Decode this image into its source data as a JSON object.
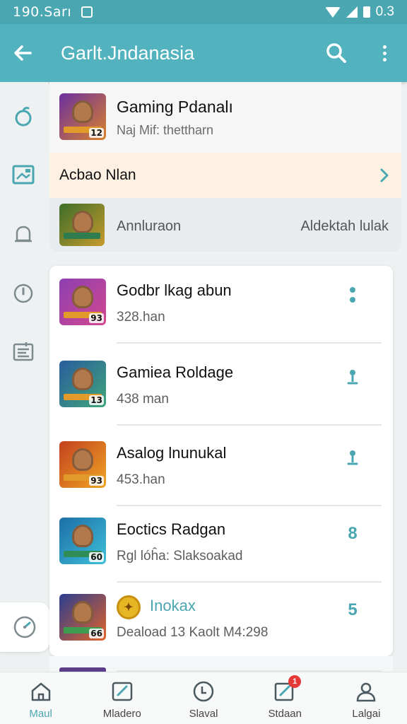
{
  "status_bar": {
    "time": "190.Sarı",
    "right_text": "0.3"
  },
  "app_bar": {
    "title": "Garlt.Jndanasia",
    "back_icon": "back-arrow-icon",
    "search_icon": "search-icon",
    "more_icon": "more-vert-icon"
  },
  "rail": {
    "items": [
      "apple-icon",
      "image-card-icon",
      "bell-icon",
      "clock-icon",
      "checklist-icon",
      "gauge-icon"
    ]
  },
  "featured": {
    "title": "Gaming Pdanalı",
    "subtitle": "Naj Mif: thettharn",
    "thumb_badge": "12",
    "action_label": "Acbao Nlan",
    "annotation_label": "Annluraon",
    "annotation_right": "Aldektah lulak"
  },
  "list": [
    {
      "title": "Godbr lkag abun",
      "subtitle": "328.han",
      "badge": "93",
      "action": "dots",
      "colors": [
        "#8d3fb3",
        "#d2488f"
      ]
    },
    {
      "title": "Gamiea Roldage",
      "subtitle": "438 man",
      "badge": "13",
      "action": "pin",
      "colors": [
        "#2a5d9e",
        "#3fa57a"
      ]
    },
    {
      "title": "Asalog lnunukal",
      "subtitle": "453.han",
      "badge": "93",
      "action": "pin",
      "colors": [
        "#c2411e",
        "#f0a524"
      ]
    },
    {
      "title": "Eoctics Radgan",
      "subtitle": "Rgl lóĥa: Slaksoakad",
      "badge": "60",
      "action": "8",
      "colors": [
        "#1d6ea8",
        "#3ec0d8"
      ]
    },
    {
      "title": "Inokax",
      "subtitle": "Deaload 13 Kaolt M4:298",
      "badge": "66",
      "action": "5",
      "colors": [
        "#2b3d8f",
        "#e0632a"
      ],
      "has_coin": true
    }
  ],
  "bottom_nav": [
    {
      "label": "Maul",
      "icon": "home-icon",
      "active": true
    },
    {
      "label": "Mladero",
      "icon": "edit-square-icon",
      "active": false
    },
    {
      "label": "Slaval",
      "icon": "clock-icon",
      "active": false
    },
    {
      "label": "Stdaan",
      "icon": "compose-icon",
      "active": false,
      "badge": "1"
    },
    {
      "label": "Lalgai",
      "icon": "person-icon",
      "active": false
    }
  ],
  "colors": {
    "accent": "#4aa6b1",
    "app_bar": "#52b2bd",
    "highlight_row": "#fdf1e3"
  }
}
